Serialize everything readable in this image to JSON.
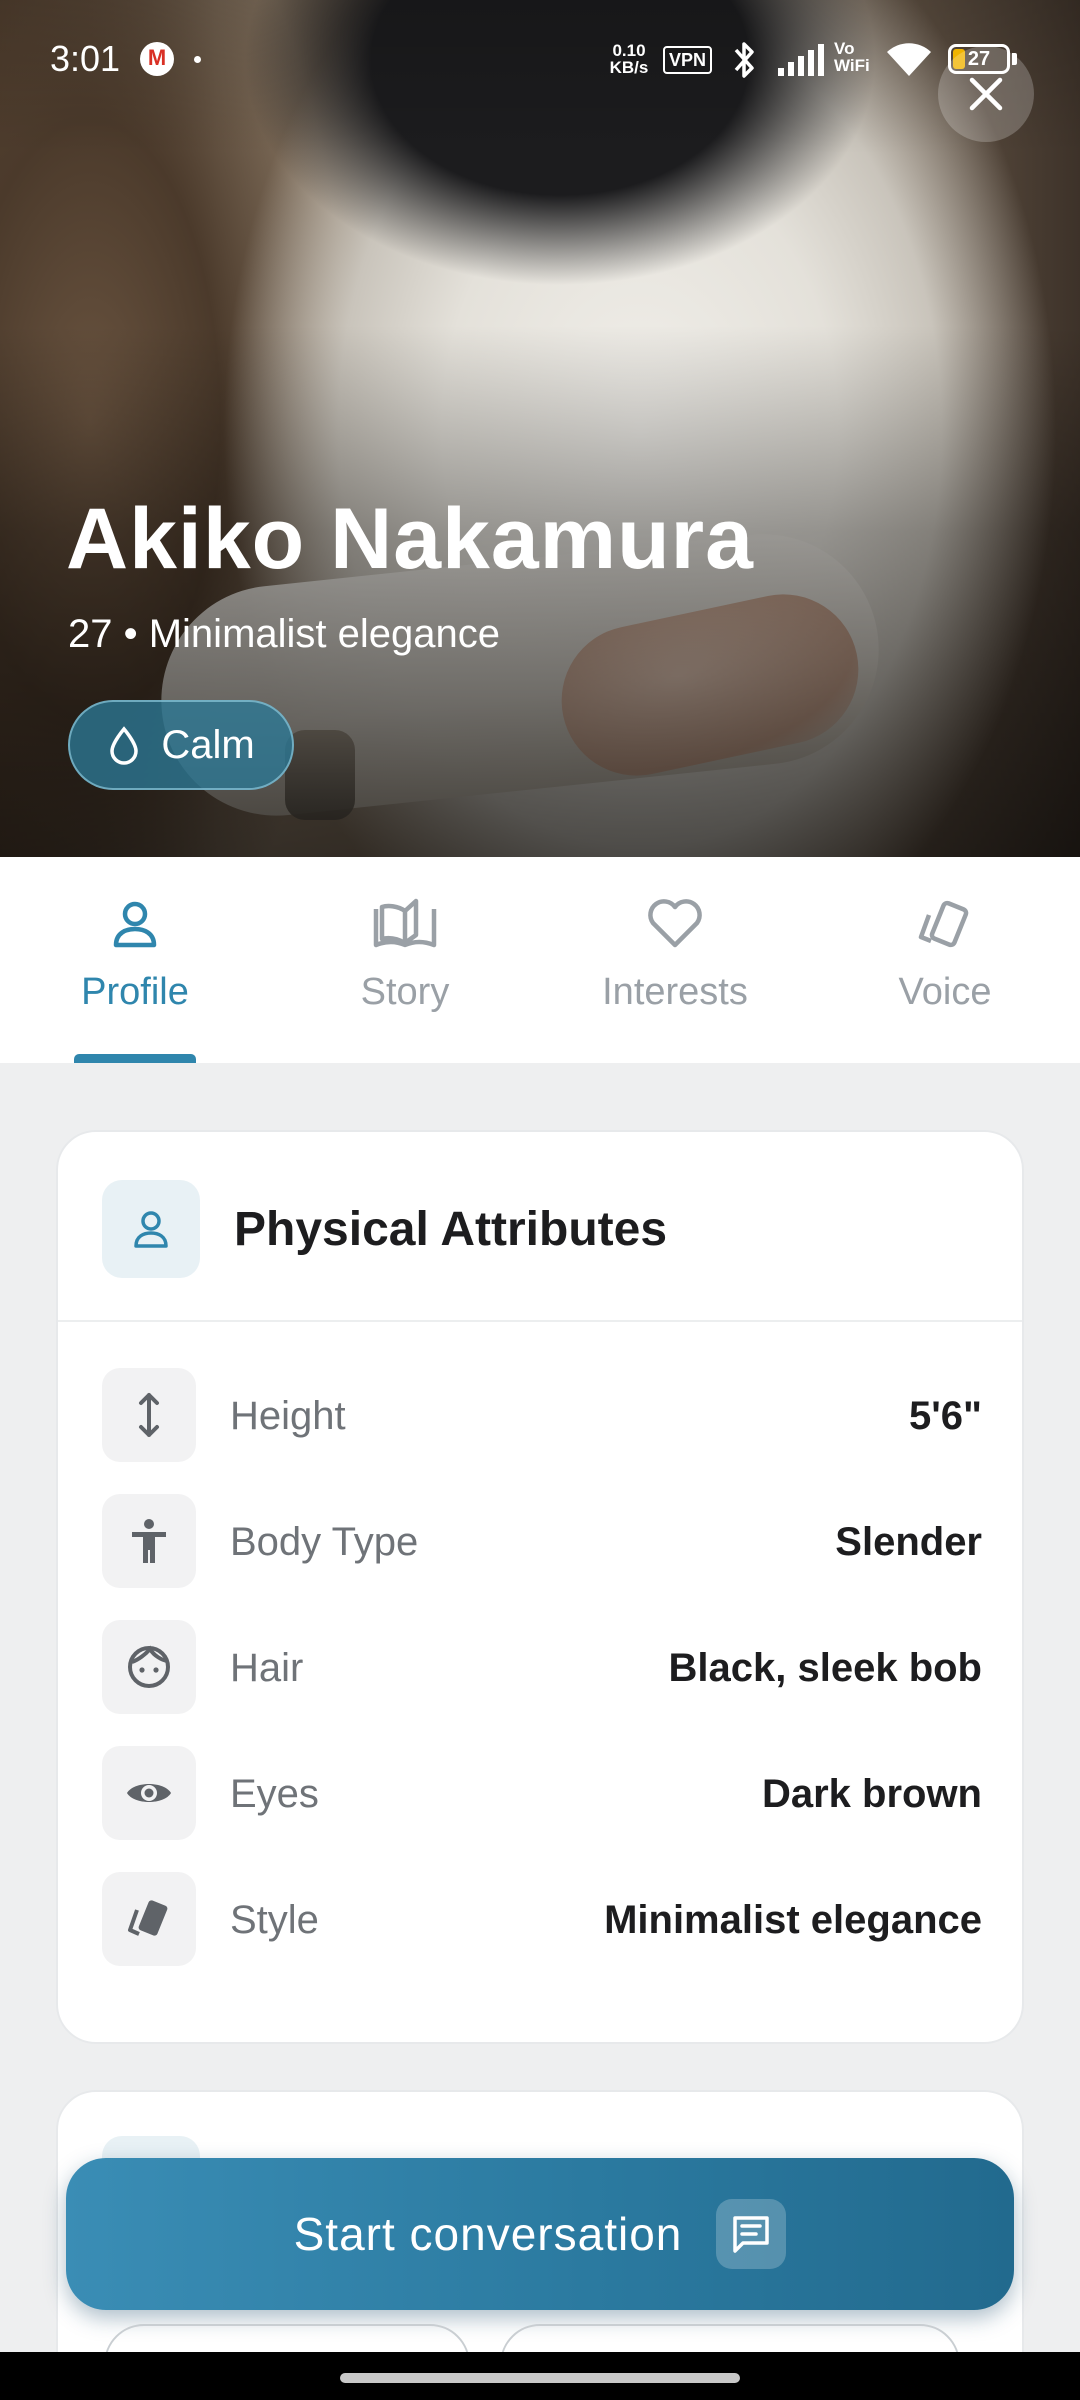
{
  "status_bar": {
    "time": "3:01",
    "net_speed_value": "0.10",
    "net_speed_unit": "KB/s",
    "vpn": "VPN",
    "vowifi_top": "Vo",
    "vowifi_bottom": "WiFi",
    "battery": "27"
  },
  "profile": {
    "name": "Akiko Nakamura",
    "subtitle": "27 • Minimalist elegance",
    "mood": "Calm"
  },
  "tabs": [
    {
      "label": "Profile",
      "icon": "person-icon",
      "active": true
    },
    {
      "label": "Story",
      "icon": "book-icon",
      "active": false
    },
    {
      "label": "Interests",
      "icon": "heart-icon",
      "active": false
    },
    {
      "label": "Voice",
      "icon": "style-icon",
      "active": false
    }
  ],
  "card": {
    "title": "Physical Attributes",
    "rows": [
      {
        "label": "Height",
        "value": "5'6\"",
        "icon": "height-icon"
      },
      {
        "label": "Body Type",
        "value": "Slender",
        "icon": "body-icon"
      },
      {
        "label": "Hair",
        "value": "Black, sleek bob",
        "icon": "face-icon"
      },
      {
        "label": "Eyes",
        "value": "Dark brown",
        "icon": "eye-icon"
      },
      {
        "label": "Style",
        "value": "Minimalist elegance",
        "icon": "style-icon"
      }
    ]
  },
  "cta": {
    "label": "Start conversation",
    "icon": "chat-icon"
  },
  "colors": {
    "accent": "#2f86ad",
    "cta_start": "#3a8db5",
    "cta_end": "#226a8e"
  }
}
